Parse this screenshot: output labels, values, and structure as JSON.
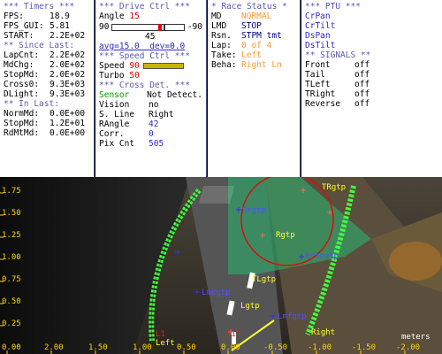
{
  "timers": {
    "header": "*** Timers ***",
    "fps_label": "FPS:",
    "fps_value": "18.9",
    "fpsgui_label": "FPS_GUI:",
    "fpsgui_value": "5.81",
    "start_label": "START:",
    "start_value": "2.2E+02",
    "since_header": "** Since Last:",
    "lapcnt_label": "LapCnt:",
    "lapcnt_value": "2.2E+02",
    "mdchg_label": "MdChg:",
    "mdchg_value": "2.0E+02",
    "stopmd_label": "StopMd:",
    "stopmd_value": "2.0E+02",
    "cross0_label": "Cross0:",
    "cross0_value": "9.3E+03",
    "dlight_label": "DLight:",
    "dlight_value": "9.3E+03",
    "inlast_header": "** In Last:",
    "normmd_label": "NormMd:",
    "normmd_value": "0.0E+00",
    "stopmd2_label": "StopMd:",
    "stopmd2_value": "1.2E+01",
    "rdmtmd_label": "RdMtMd:",
    "rdmtmd_value": "0.0E+00"
  },
  "drive": {
    "header": "*** Drive Ctrl ***",
    "angle_label": "Angle",
    "angle_value": "15",
    "slider_min": "90",
    "slider_max": "-90",
    "slider_fraction": 0.58,
    "mid_value": "45",
    "avg_text": "avg=15.0  dev=0.0",
    "speed_header": "*** Speed Ctrl ***",
    "speed_label": "Speed",
    "speed_value": "90",
    "speed_fraction": 1.0,
    "turbo_label": "Turbo",
    "turbo_value": "50",
    "cross_header": "*** Cross Det. ***",
    "sensor_label": "Sensor",
    "sensor_value": "Not Detect.",
    "vision_label": "Vision",
    "vision_value": "no",
    "sline_label": "S. Line",
    "sline_value": "Right",
    "rangle_label": "RAngle",
    "rangle_value": "42",
    "corr_label": "Corr.",
    "corr_value": "0",
    "pix_label": "Pix Cnt",
    "pix_value": "505"
  },
  "race": {
    "header": "* Race Status *",
    "md_label": "MD",
    "md_value": "NORMAL",
    "lmd_label": "LMD",
    "lmd_value": "STOP",
    "rsn_label": "Rsn.",
    "rsn_value": "STPM tmt",
    "lap_label": "Lap:",
    "lap_value": "0 of 4",
    "take_label": "Take:",
    "take_value": "Left",
    "beha_label": "Beha:",
    "beha_value": "Right Ln"
  },
  "ptu": {
    "header": "*** PTU ***",
    "items": [
      "CrPan",
      "CrTilt",
      "DsPan",
      "DsTilt"
    ],
    "signals_header": "** SIGNALS **",
    "signals": [
      {
        "label": "Front",
        "value": "off"
      },
      {
        "label": "Tail",
        "value": "off"
      },
      {
        "label": "TLeft",
        "value": "off"
      },
      {
        "label": "TRight",
        "value": "off"
      },
      {
        "label": "Reverse",
        "value": "off"
      }
    ]
  },
  "camera": {
    "y_ticks": [
      "1.75",
      "1.50",
      "1.25",
      "1.00",
      "0.75",
      "0.50",
      "0.25",
      "0.00"
    ],
    "x_ticks": [
      "0.00",
      "2.00",
      "1.50",
      "1.00",
      "0.50",
      "0.00",
      "-0.50",
      "-1.00",
      "-1.50",
      "-2.00"
    ],
    "unit": "meters",
    "labels": {
      "trgtp": "TRgtp",
      "rrgtp": "Rrgtp",
      "rgtp": "Rgtp",
      "rrtcgtp": "Rrtcgtp",
      "lmcgtp": "Lmcgtp",
      "tlgtp": "TLgtp",
      "lgtp": "Lgtp",
      "lmfgtp": "Lmfgtp",
      "left": "Left",
      "right": "Right",
      "l1": "L1",
      "r13": "R13"
    }
  },
  "colors": {
    "header": "#5a5ab0",
    "value_blue": "#2a2acc",
    "value_orange": "#ff9933",
    "value_red": "#e60000",
    "value_green": "#00a000",
    "axis_yellow": "#ffd400",
    "lane_green": "#40ff40"
  }
}
